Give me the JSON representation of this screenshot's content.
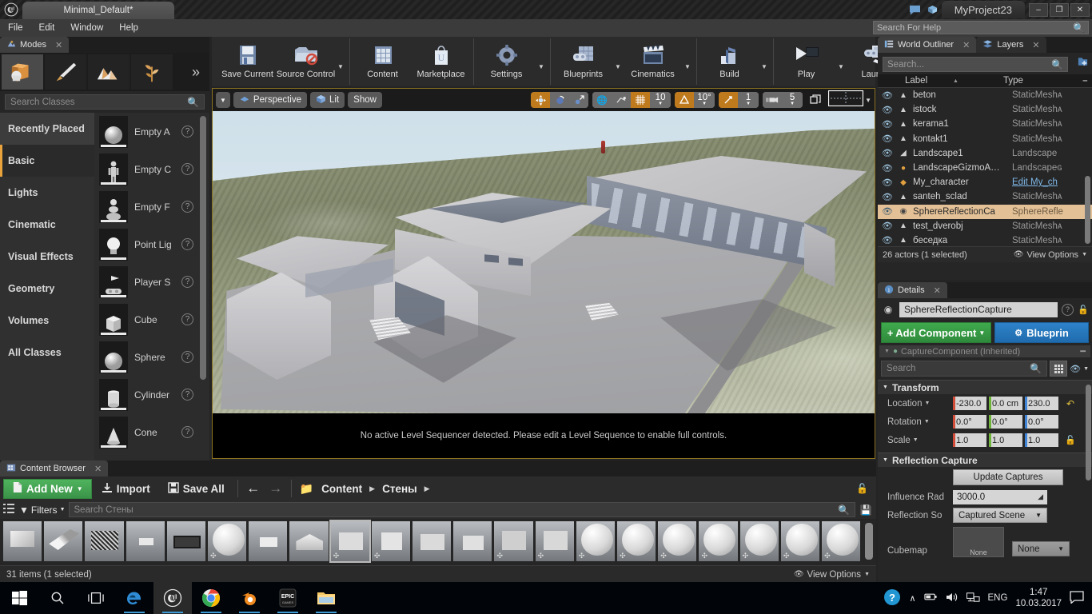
{
  "titlebar": {
    "level_tab": "Minimal_Default*",
    "project_name": "MyProject23",
    "minimize": "–",
    "restore": "❐",
    "close": "✕"
  },
  "menubar": {
    "items": [
      "File",
      "Edit",
      "Window",
      "Help"
    ],
    "help_search_placeholder": "Search For Help"
  },
  "toolbar": {
    "groups": [
      {
        "buttons": [
          {
            "label": "Save Current",
            "icon": "floppy-disk-icon",
            "caret": false
          },
          {
            "label": "Source Control",
            "icon": "source-control-icon",
            "caret": true
          }
        ]
      },
      {
        "buttons": [
          {
            "label": "Content",
            "icon": "content-grid-icon",
            "caret": false
          },
          {
            "label": "Marketplace",
            "icon": "marketplace-bag-icon",
            "caret": false
          }
        ]
      },
      {
        "buttons": [
          {
            "label": "Settings",
            "icon": "gear-icon",
            "caret": true
          }
        ]
      },
      {
        "buttons": [
          {
            "label": "Blueprints",
            "icon": "blueprint-icon",
            "caret": true
          },
          {
            "label": "Cinematics",
            "icon": "clapperboard-icon",
            "caret": true
          }
        ]
      },
      {
        "buttons": [
          {
            "label": "Build",
            "icon": "build-blocks-icon",
            "caret": true
          }
        ]
      },
      {
        "buttons": [
          {
            "label": "Play",
            "icon": "play-icon",
            "caret": true
          },
          {
            "label": "Launch",
            "icon": "launch-icon",
            "caret": true
          }
        ]
      }
    ]
  },
  "modes": {
    "tab_label": "Modes",
    "tools": [
      "place-mode-icon",
      "paint-mode-icon",
      "landscape-mode-icon",
      "foliage-mode-icon"
    ],
    "expand": "»",
    "search_placeholder": "Search Classes",
    "categories": [
      {
        "label": "Recently Placed",
        "selected": false,
        "hover": true
      },
      {
        "label": "Basic",
        "selected": true,
        "hover": false
      },
      {
        "label": "Lights",
        "selected": false,
        "hover": false
      },
      {
        "label": "Cinematic",
        "selected": false,
        "hover": false
      },
      {
        "label": "Visual Effects",
        "selected": false,
        "hover": false
      },
      {
        "label": "Geometry",
        "selected": false,
        "hover": false
      },
      {
        "label": "Volumes",
        "selected": false,
        "hover": false
      },
      {
        "label": "All Classes",
        "selected": false,
        "hover": false
      }
    ],
    "assets": [
      {
        "label": "Empty A",
        "thumb": "sphere"
      },
      {
        "label": "Empty C",
        "thumb": "character"
      },
      {
        "label": "Empty F",
        "thumb": "pawn"
      },
      {
        "label": "Point Lig",
        "thumb": "bulb"
      },
      {
        "label": "Player S",
        "thumb": "gamepad"
      },
      {
        "label": "Cube",
        "thumb": "cube"
      },
      {
        "label": "Sphere",
        "thumb": "sphere"
      },
      {
        "label": "Cylinder",
        "thumb": "cylinder"
      },
      {
        "label": "Cone",
        "thumb": "cone"
      }
    ],
    "help_glyph": "?"
  },
  "viewport": {
    "view_menu_caret": "▼",
    "perspective_label": "Perspective",
    "lit_label": "Lit",
    "show_label": "Show",
    "transform_tools": [
      "translate-gizmo-icon",
      "rotate-gizmo-icon",
      "scale-gizmo-icon"
    ],
    "coord_space_icon": "world-space-icon",
    "surface_snap_icon": "surface-snap-icon",
    "grid_snap_icon": "grid-snap-icon",
    "grid_snap_value": "10",
    "angle_snap_icon": "angle-snap-icon",
    "angle_snap_value": "10°",
    "scale_snap_icon": "scale-snap-icon",
    "scale_snap_value": "1",
    "camera_speed_icon": "camera-speed-icon",
    "camera_speed_value": "5",
    "maximize_icon": "maximize-viewport-icon",
    "layout_icon": "viewport-layout-icon",
    "layout_caret": "▼",
    "sequencer_message": "No active Level Sequencer detected. Please edit a Level Sequence to enable full controls."
  },
  "outliner": {
    "tabs": [
      {
        "label": "World Outliner",
        "active": true,
        "icon": "outliner-icon"
      },
      {
        "label": "Layers",
        "active": false,
        "icon": "layers-icon"
      }
    ],
    "search_placeholder": "Search...",
    "add_icon": "add-folder-icon",
    "columns": {
      "label": "Label",
      "type": "Type",
      "sort_glyph": "▲"
    },
    "rows": [
      {
        "label": "beton",
        "type": "StaticMeshᴀ",
        "icon": "staticmesh-icon",
        "selected": false
      },
      {
        "label": "istock",
        "type": "StaticMeshᴀ",
        "icon": "staticmesh-icon",
        "selected": false
      },
      {
        "label": "kerama1",
        "type": "StaticMeshᴀ",
        "icon": "staticmesh-icon",
        "selected": false
      },
      {
        "label": "kontakt1",
        "type": "StaticMeshᴀ",
        "icon": "staticmesh-icon",
        "selected": false
      },
      {
        "label": "Landscape1",
        "type": "Landscape",
        "icon": "landscape-icon",
        "selected": false
      },
      {
        "label": "LandscapeGizmoA…",
        "type": "Landscapeɢ",
        "icon": "gizmo-icon",
        "selected": false
      },
      {
        "label": "My_character",
        "type": "Edit My_ch",
        "icon": "character-icon",
        "selected": false,
        "type_is_link": true
      },
      {
        "label": "santeh_sclad",
        "type": "StaticMeshᴀ",
        "icon": "staticmesh-icon",
        "selected": false
      },
      {
        "label": "SphereReflectionCa",
        "type": "SphereRefle",
        "icon": "reflection-capture-icon",
        "selected": true
      },
      {
        "label": "test_dverobj",
        "type": "StaticMeshᴀ",
        "icon": "staticmesh-icon",
        "selected": false
      },
      {
        "label": "беседка",
        "type": "StaticMeshᴀ",
        "icon": "staticmesh-icon",
        "selected": false
      }
    ],
    "footer_count": "26 actors (1 selected)",
    "view_options": "View Options"
  },
  "details": {
    "tab_label": "Details",
    "actor_name": "SphereReflectionCapture",
    "lock_icon": "lock-icon",
    "help_icon": "help-icon",
    "add_component_label": "Add Component",
    "blueprint_label": "Blueprin",
    "component_row": "CaptureComponent (Inherited)",
    "search_placeholder": "Search",
    "grid_view_icon": "grid-view-icon",
    "eye_icon": "eye-icon",
    "sections": {
      "transform": {
        "title": "Transform",
        "rows": [
          {
            "label": "Location",
            "values": [
              "-230.0",
              "0.0 cm",
              "230.0"
            ],
            "reset": true
          },
          {
            "label": "Rotation",
            "values": [
              "0.0°",
              "0.0°",
              "0.0°"
            ],
            "reset": false
          },
          {
            "label": "Scale",
            "values": [
              "1.0",
              "1.0",
              "1.0"
            ],
            "reset": false,
            "lock": true
          }
        ]
      },
      "reflection": {
        "title": "Reflection Capture",
        "update_button": "Update Captures",
        "influence_label": "Influence Rad",
        "influence_value": "3000.0",
        "source_label": "Reflection So",
        "source_value": "Captured Scene",
        "cubemap_label": "Cubemap",
        "cubemap_thumb": "None",
        "cubemap_value": "None"
      }
    }
  },
  "content_browser": {
    "tab_label": "Content Browser",
    "add_new": "Add New",
    "import": "Import",
    "save_all": "Save All",
    "back_icon": "arrow-left-icon",
    "forward_icon": "arrow-right-icon",
    "breadcrumb": [
      "Content",
      "Стены"
    ],
    "filters_label": "Filters",
    "search_placeholder": "Search Стены",
    "lock_icon": "lock-icon",
    "tiles": [
      {
        "kind": "mesh",
        "selected": false
      },
      {
        "kind": "mesh",
        "selected": false
      },
      {
        "kind": "mesh",
        "selected": false
      },
      {
        "kind": "mesh",
        "selected": false
      },
      {
        "kind": "mesh",
        "selected": false
      },
      {
        "kind": "material-sphere",
        "selected": false
      },
      {
        "kind": "mesh",
        "selected": false
      },
      {
        "kind": "mesh",
        "selected": false
      },
      {
        "kind": "material-mesh",
        "selected": true
      },
      {
        "kind": "material-mesh",
        "selected": false
      },
      {
        "kind": "mesh",
        "selected": false
      },
      {
        "kind": "mesh",
        "selected": false
      },
      {
        "kind": "material-mesh",
        "selected": false
      },
      {
        "kind": "material-mesh",
        "selected": false
      },
      {
        "kind": "material-sphere",
        "selected": false
      },
      {
        "kind": "material-sphere",
        "selected": false
      },
      {
        "kind": "material-sphere",
        "selected": false
      },
      {
        "kind": "material-sphere",
        "selected": false
      },
      {
        "kind": "material-sphere",
        "selected": false
      },
      {
        "kind": "material-sphere",
        "selected": false
      },
      {
        "kind": "material-sphere",
        "selected": false
      },
      {
        "kind": "material-sphere",
        "selected": false
      }
    ],
    "footer_count": "31 items (1 selected)",
    "view_options": "View Options"
  },
  "taskbar": {
    "items": [
      {
        "name": "start-button",
        "icon": "windows-logo-icon",
        "open": false
      },
      {
        "name": "search-button",
        "icon": "search-icon",
        "open": false
      },
      {
        "name": "task-view-button",
        "icon": "task-view-icon",
        "open": false
      },
      {
        "name": "edge-button",
        "icon": "edge-icon",
        "open": true
      },
      {
        "name": "unreal-button",
        "icon": "unreal-icon",
        "open": true,
        "active": true
      },
      {
        "name": "chrome-button",
        "icon": "chrome-icon",
        "open": true
      },
      {
        "name": "blender-button",
        "icon": "blender-icon",
        "open": true
      },
      {
        "name": "epic-games-button",
        "icon": "epic-games-icon",
        "open": true
      },
      {
        "name": "explorer-button",
        "icon": "folder-icon",
        "open": true
      }
    ],
    "help_bubble_icon": "help-circle-icon",
    "chevron": "∧",
    "tray_icons": [
      "battery-icon",
      "volume-icon",
      "network-icon"
    ],
    "language": "ENG",
    "time": "1:47",
    "date": "10.03.2017",
    "action_center_icon": "notification-icon"
  }
}
